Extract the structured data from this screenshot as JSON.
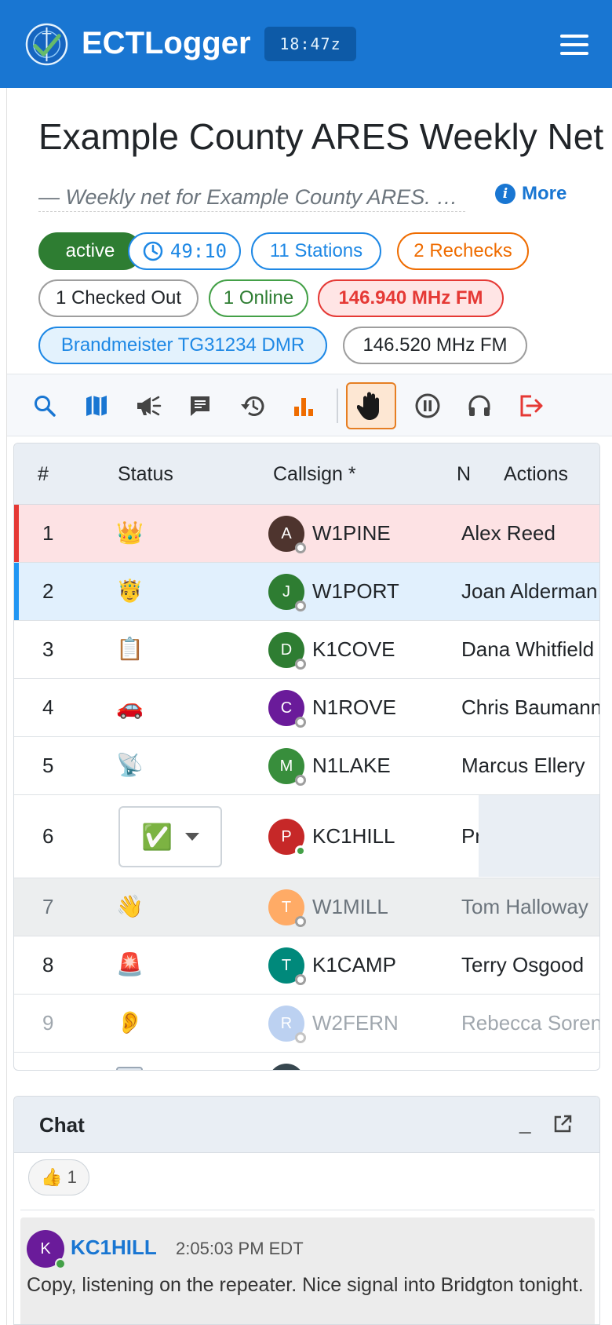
{
  "header": {
    "brand": "ECTLogger",
    "clock": "18:47z"
  },
  "net": {
    "title": "Example County ARES Weekly Net",
    "description": "— Weekly net for Example County ARES. C...",
    "more_label": "More"
  },
  "badges": {
    "status": "active",
    "timer": "49:10",
    "stations": "11 Stations",
    "rechecks": "2 Rechecks",
    "checked_out": "1 Checked Out",
    "online": "1 Online",
    "freq_primary": "146.940 MHz FM",
    "dmr": "Brandmeister TG31234 DMR",
    "freq_secondary": "146.520 MHz FM"
  },
  "toolbar": {
    "icons": [
      "search-icon",
      "map-icon",
      "announce-icon",
      "script-icon",
      "history-icon",
      "stats-icon",
      "hand-raise-icon",
      "pause-icon",
      "headphones-icon",
      "leave-icon"
    ],
    "accent": "#1976d2",
    "active_accent": "#e67e22"
  },
  "table": {
    "headers": {
      "num": "#",
      "status": "Status",
      "callsign": "Callsign *",
      "name": "N",
      "actions": "Actions"
    },
    "rows": [
      {
        "num": "1",
        "status": "👑",
        "initial": "A",
        "callsign": "W1PINE",
        "name": "Alex Reed",
        "avatar_color": "#4e342e"
      },
      {
        "num": "2",
        "status": "🤴",
        "initial": "J",
        "callsign": "W1PORT",
        "name": "Joan Alderman",
        "avatar_color": "#2e7d32"
      },
      {
        "num": "3",
        "status": "📋",
        "initial": "D",
        "callsign": "K1COVE",
        "name": "Dana Whitfield",
        "avatar_color": "#2e7d32"
      },
      {
        "num": "4",
        "status": "🚗",
        "initial": "C",
        "callsign": "N1ROVE",
        "name": "Chris Baumann",
        "avatar_color": "#6a1b9a"
      },
      {
        "num": "5",
        "status": "📡",
        "initial": "M",
        "callsign": "N1LAKE",
        "name": "Marcus Ellery",
        "avatar_color": "#388e3c"
      },
      {
        "num": "6",
        "status": "✅",
        "initial": "P",
        "callsign": "KC1HILL",
        "name": "Pr",
        "avatar_color": "#c62828"
      },
      {
        "num": "7",
        "status": "👋",
        "initial": "T",
        "callsign": "W1MILL",
        "name": "Tom Halloway",
        "avatar_color": "#ffab66"
      },
      {
        "num": "8",
        "status": "🚨",
        "initial": "T",
        "callsign": "K1CAMP",
        "name": "Terry Osgood",
        "avatar_color": "#00897b"
      },
      {
        "num": "9",
        "status": "👂",
        "initial": "R",
        "callsign": "W2FERN",
        "name": "Rebecca Sorensen",
        "avatar_color": "#90b4e8"
      }
    ]
  },
  "chat": {
    "title": "Chat",
    "minimize": "_",
    "reaction": {
      "emoji": "👍",
      "count": "1"
    },
    "message": {
      "initial": "K",
      "from": "KC1HILL",
      "time": "2:05:03 PM EDT",
      "text": "Copy, listening on the repeater. Nice signal into Bridgton tonight."
    }
  }
}
